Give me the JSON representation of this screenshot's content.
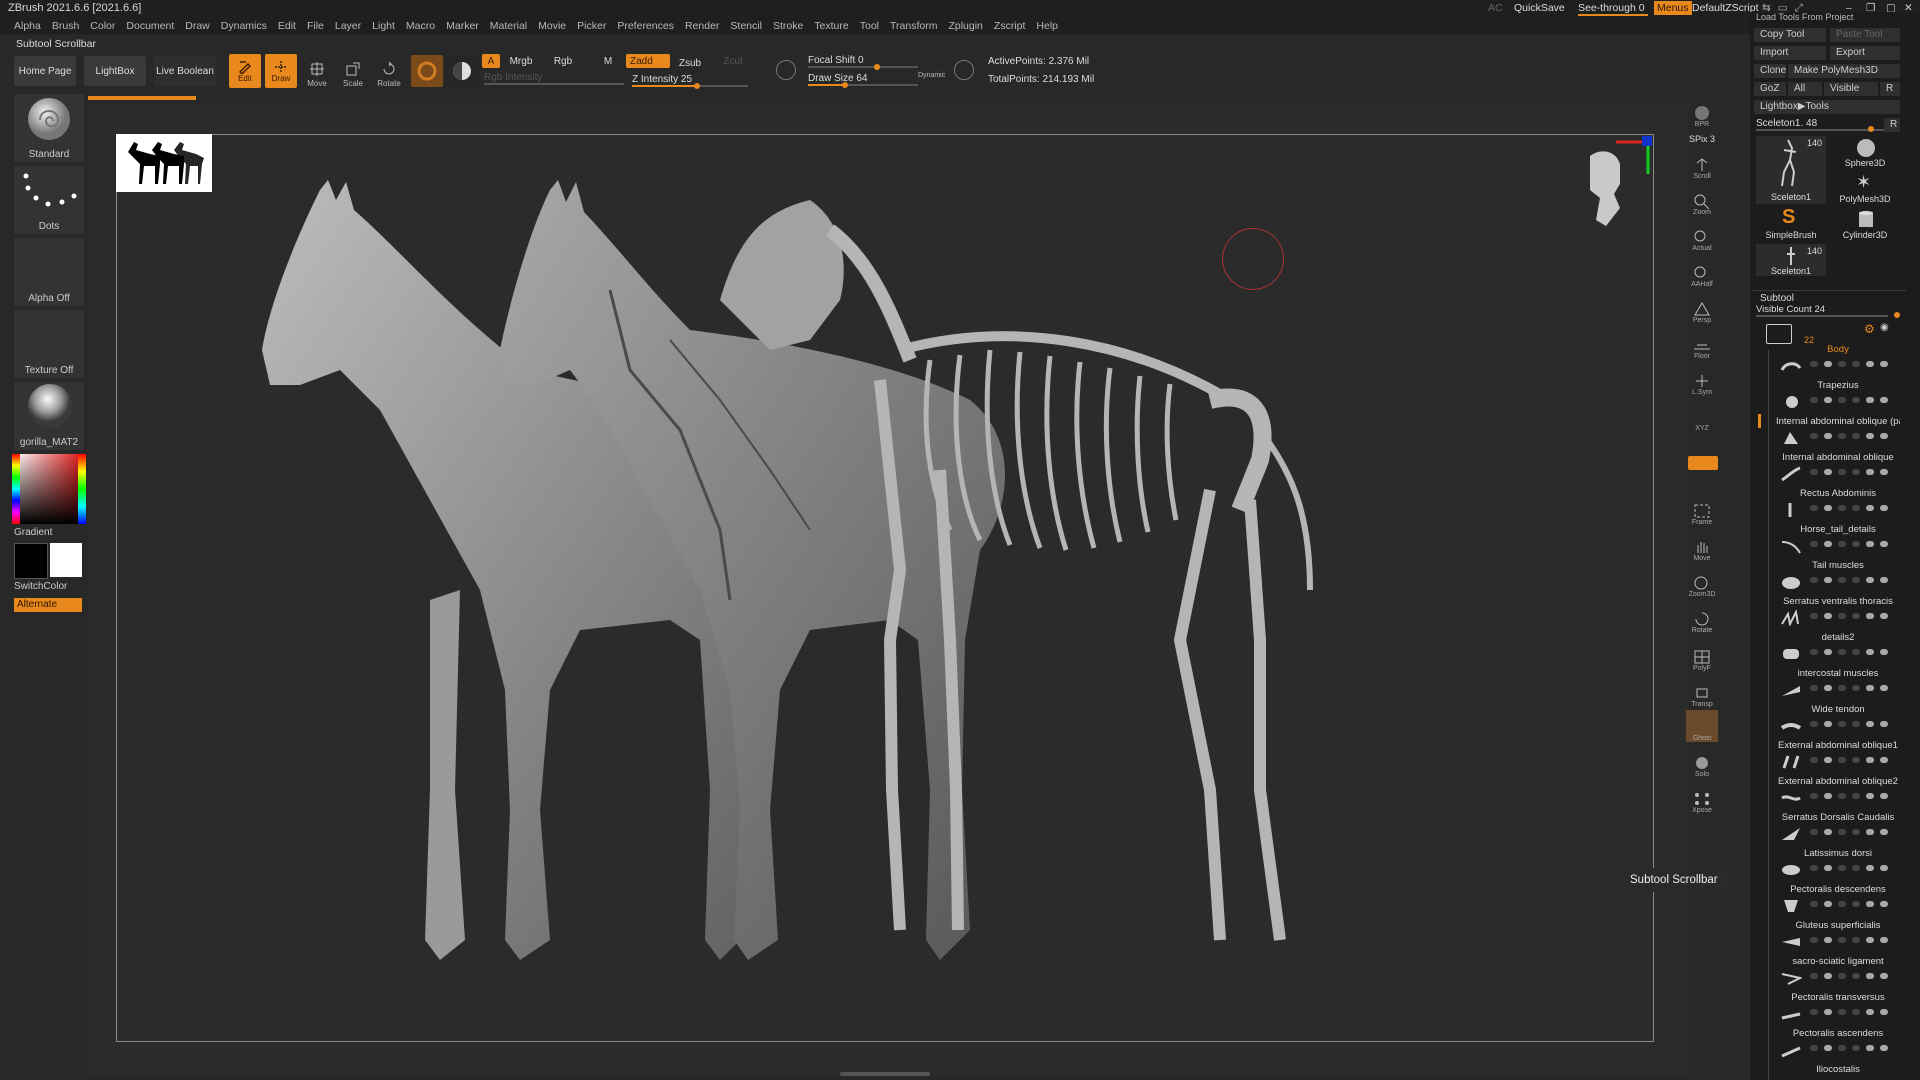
{
  "window": {
    "title": "ZBrush 2021.6.6 [2021.6.6]",
    "status_label": "Subtool Scrollbar"
  },
  "menu": [
    "Alpha",
    "Brush",
    "Color",
    "Document",
    "Draw",
    "Dynamics",
    "Edit",
    "File",
    "Layer",
    "Light",
    "Macro",
    "Marker",
    "Material",
    "Movie",
    "Picker",
    "Preferences",
    "Render",
    "Stencil",
    "Stroke",
    "Texture",
    "Tool",
    "Transform",
    "Zplugin",
    "Zscript",
    "Help"
  ],
  "topright": {
    "ac": "AC",
    "quicksave": "QuickSave",
    "see_through": "See-through",
    "see_through_value": "0",
    "menus": "Menus",
    "script": "DefaultZScript"
  },
  "toolbar": {
    "home_page": "Home Page",
    "lightbox": "LightBox",
    "live_boolean": "Live Boolean",
    "edit": "Edit",
    "draw": "Draw",
    "move": "Move",
    "scale": "Scale",
    "rotate": "Rotate",
    "a": "A",
    "mrgb": "Mrgb",
    "rgb": "Rgb",
    "m": "M",
    "zadd": "Zadd",
    "zsub": "Zsub",
    "zcut": "Zcut",
    "rgb_intensity": "Rgb Intensity",
    "z_intensity": "Z Intensity 25",
    "focal_shift": "Focal Shift 0",
    "draw_size": "Draw Size 64",
    "dynamic": "Dynamic",
    "active_points": "ActivePoints: 2.376 Mil",
    "total_points": "TotalPoints: 214.193 Mil"
  },
  "left_shelf": {
    "brush": "Standard",
    "stroke": "Dots",
    "alpha": "Alpha Off",
    "texture": "Texture Off",
    "material": "gorilla_MAT2",
    "gradient": "Gradient",
    "switch_color": "SwitchColor",
    "alternate": "Alternate"
  },
  "right_toolbar": [
    "BPR",
    "SPix 3",
    "Scroll",
    "Zoom",
    "Actual",
    "AAHalf",
    "Persp",
    "Floor",
    "L.Sym",
    "XYZ",
    "Frame",
    "Move",
    "Zoom3D",
    "Rotate",
    "PolyF",
    "Transp",
    "Ghost",
    "Solo",
    "Xpose"
  ],
  "tool_panel": {
    "load_tools": "Load Tools From Project",
    "copy_tool": "Copy Tool",
    "paste_tool": "Paste Tool",
    "import": "Import",
    "export": "Export",
    "clone": "Clone",
    "make_polymesh": "Make PolyMesh3D",
    "goz": "GoZ",
    "all": "All",
    "visible": "Visible",
    "r": "R",
    "lightbox_tools": "Lightbox▶Tools",
    "current_tool": "Sceleton1. 48",
    "tools": [
      {
        "name": "Sceleton1",
        "count": "140"
      },
      {
        "name": "Sphere3D",
        "count": ""
      },
      {
        "name": "PolyMesh3D",
        "count": ""
      },
      {
        "name": "SimpleBrush",
        "count": ""
      },
      {
        "name": "Cylinder3D",
        "count": ""
      },
      {
        "name": "Sceleton1",
        "count": "140"
      }
    ]
  },
  "subtool": {
    "header": "Subtool",
    "visible_count": "Visible Count 24",
    "folder_count": "22",
    "items": [
      "Body",
      "Trapezius",
      "Internal abdominal oblique (pa",
      "Internal abdominal oblique",
      "Rectus Abdominis",
      "Horse_tail_details",
      "Tail muscles",
      "Serratus ventralis thoracis",
      "details2",
      "intercostal muscles",
      "Wide tendon",
      "External abdominal oblique1",
      "External abdominal oblique2",
      "Serratus Dorsalis Caudalis",
      "Latissimus dorsi",
      "Pectoralis descendens",
      "Gluteus superficialis",
      "sacro-sciatic ligament",
      "Pectoralis transversus",
      "Pectoralis ascendens",
      "Iliocostalis"
    ]
  },
  "tooltip": "Subtool Scrollbar",
  "colors": {
    "accent": "#e9891d",
    "panel": "#1c1c1c",
    "canvas": "#2b2b2b"
  }
}
